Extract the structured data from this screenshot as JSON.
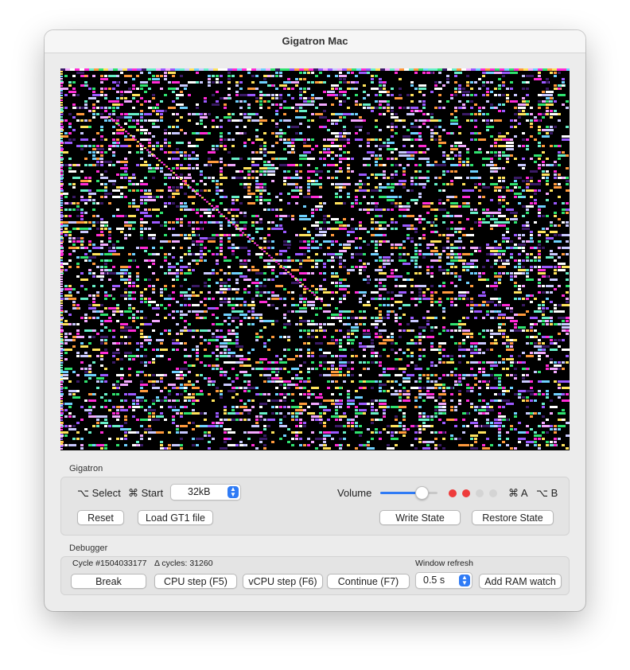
{
  "window": {
    "title": "Gigatron Mac"
  },
  "screen": {
    "palette": [
      "#ff2bd6",
      "#9b59ff",
      "#f3a9ff",
      "#67f0c8",
      "#6fd1ff",
      "#ffe35c",
      "#ffffff",
      "#3a1a66",
      "#2fe36f",
      "#ff9a3c",
      "#c9c9ff"
    ]
  },
  "gigatron": {
    "group_label": "Gigatron",
    "select_label": "⌥ Select",
    "start_label": "⌘ Start",
    "ram_popup": {
      "value": "32kB"
    },
    "volume_label": "Volume",
    "volume_level": 0.72,
    "leds": [
      "on",
      "on",
      "off",
      "off"
    ],
    "led_colors": {
      "on": "#ee3b3b",
      "off": "#d4d4d4"
    },
    "a_label": "⌘ A",
    "b_label": "⌥ B",
    "reset_button": "Reset",
    "load_button": "Load GT1 file",
    "write_state_button": "Write State",
    "restore_state_button": "Restore State"
  },
  "debugger": {
    "group_label": "Debugger",
    "cycle": "Cycle #1504033177",
    "delta_cycles": "Δ cycles: 31260",
    "window_refresh_label": "Window refresh",
    "break_button": "Break",
    "cpu_step_button": "CPU step (F5)",
    "vcpu_step_button": "vCPU step (F6)",
    "continue_button": "Continue (F7)",
    "refresh_popup": {
      "value": "0.5 s"
    },
    "add_ram_watch_button": "Add RAM watch"
  },
  "colors": {
    "accent": "#2f7bf5"
  }
}
